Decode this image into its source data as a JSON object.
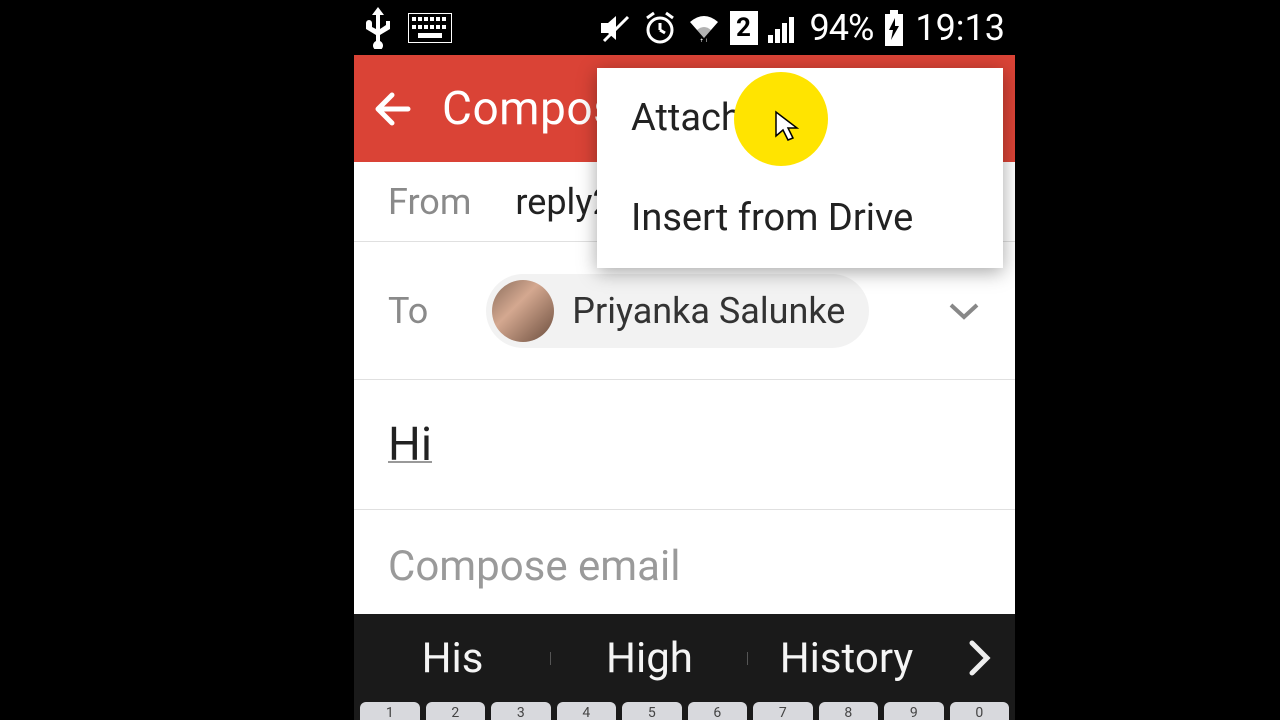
{
  "status": {
    "battery": "94%",
    "time": "19:13",
    "sim_badge": "2"
  },
  "app_bar": {
    "title": "Compose"
  },
  "from": {
    "label": "From",
    "value": "reply2"
  },
  "to": {
    "label": "To",
    "name": "Priyanka Salunke"
  },
  "subject": "Hi",
  "body": {
    "placeholder": "Compose email"
  },
  "popup": {
    "items": [
      "Attach file",
      "Insert from Drive"
    ]
  },
  "suggestions": [
    "His",
    "High",
    "History"
  ],
  "num_keys": [
    "1",
    "2",
    "3",
    "4",
    "5",
    "6",
    "7",
    "8",
    "9",
    "0"
  ]
}
